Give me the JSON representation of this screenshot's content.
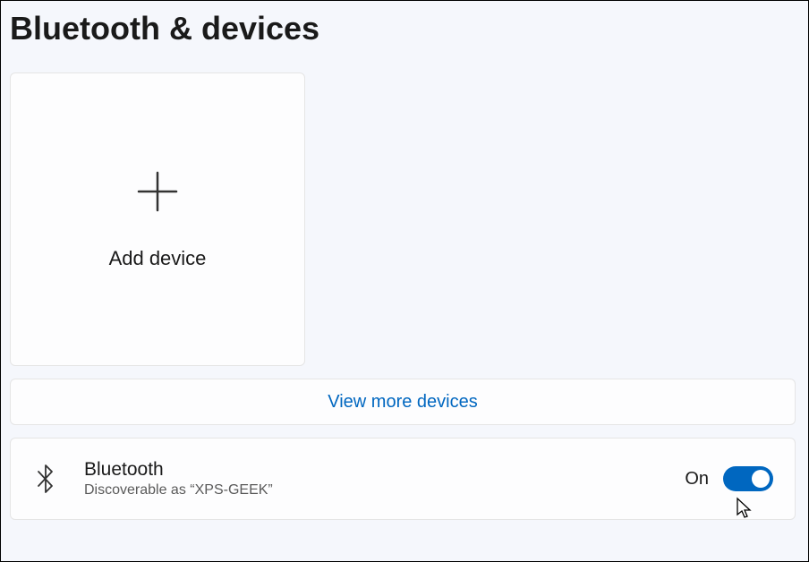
{
  "page": {
    "title": "Bluetooth & devices"
  },
  "addDevice": {
    "label": "Add device"
  },
  "viewMore": {
    "label": "View more devices"
  },
  "bluetooth": {
    "title": "Bluetooth",
    "subtitle": "Discoverable as “XPS-GEEK”",
    "state": "On",
    "enabled": true
  }
}
